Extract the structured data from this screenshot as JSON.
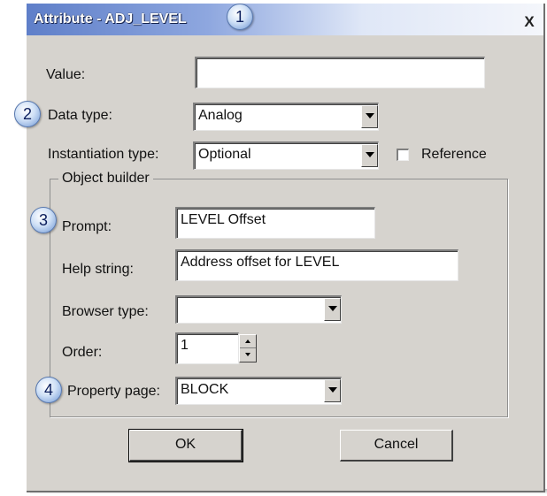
{
  "window": {
    "title": "Attribute - ADJ_LEVEL",
    "close_label": "X"
  },
  "callouts": [
    "1",
    "2",
    "3",
    "4"
  ],
  "fields": {
    "value": {
      "label": "Value:",
      "value": ""
    },
    "data_type": {
      "label": "Data type:",
      "value": "Analog"
    },
    "instantiation_type": {
      "label": "Instantiation type:",
      "value": "Optional"
    },
    "reference": {
      "label": "Reference",
      "checked": false
    }
  },
  "object_builder": {
    "legend": "Object builder",
    "prompt": {
      "label": "Prompt:",
      "value": "LEVEL Offset"
    },
    "help_string": {
      "label": "Help string:",
      "value": "Address offset for LEVEL"
    },
    "browser_type": {
      "label": "Browser type:",
      "value": ""
    },
    "order": {
      "label": "Order:",
      "value": "1"
    },
    "property_page": {
      "label": "Property page:",
      "value": "BLOCK"
    }
  },
  "buttons": {
    "ok": "OK",
    "cancel": "Cancel"
  },
  "icons": {
    "close": "close-icon",
    "dropdown": "chevron-down-icon",
    "spin_up": "spin-up-icon",
    "spin_down": "spin-down-icon"
  },
  "colors": {
    "dialog_bg": "#d6d3ce",
    "title_gradient_start": "#5f7fc9",
    "title_gradient_end": "#f4f6fb",
    "callout": "#6e96d4"
  }
}
